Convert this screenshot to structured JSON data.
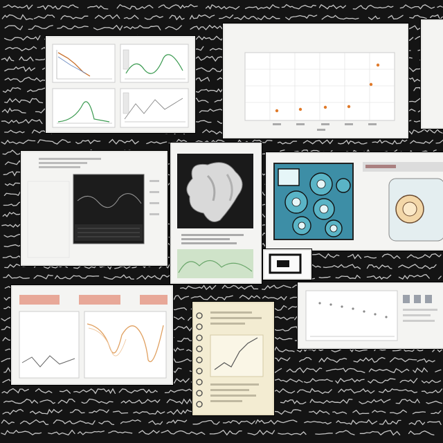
{
  "scene": {
    "background": "#141414",
    "scribble_color": "#e6e6e6",
    "panel_color": "#f4f4f2",
    "notebook_color": "#f3ecd2"
  },
  "panels": {
    "top_center": {
      "title_line1": "",
      "title_line2": ""
    }
  },
  "icons": {
    "molecule": "molecule-render-icon",
    "cells": "cell-diagram-icon",
    "device": "device-illustration-icon",
    "notebook": "spiral-notebook-icon",
    "monitor": "monitor-icon"
  }
}
